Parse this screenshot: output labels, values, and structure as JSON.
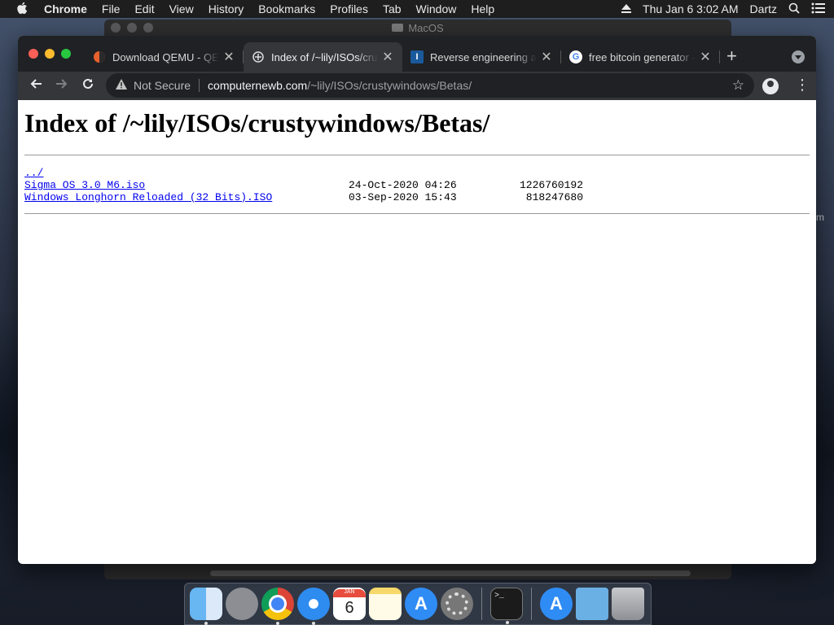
{
  "menubar": {
    "app_name": "Chrome",
    "items": [
      "File",
      "Edit",
      "View",
      "History",
      "Bookmarks",
      "Profiles",
      "Tab",
      "Window",
      "Help"
    ],
    "clock": "Thu Jan 6  3:02 AM",
    "user": "Dartz",
    "icons": [
      "apple-icon",
      "eject-icon",
      "spotlight-icon",
      "control-center-icon"
    ]
  },
  "bg_window": {
    "title": "MacOS"
  },
  "desktop": {
    "side_text": "m"
  },
  "browser": {
    "tabs": [
      {
        "title": "Download QEMU - QEMU",
        "favicon": "qemu-icon",
        "active": false
      },
      {
        "title": "Index of /~lily/ISOs/crustywindows/Betas/",
        "favicon": "site-icon",
        "active": true
      },
      {
        "title": "Reverse engineering and",
        "favicon": "I",
        "active": false
      },
      {
        "title": "free bitcoin generator - Google Search",
        "favicon": "G",
        "active": false
      }
    ],
    "new_tab_label": "+",
    "security_label": "Not Secure",
    "url_host": "computernewb.com",
    "url_path": "/~lily/ISOs/crustywindows/Betas/"
  },
  "page": {
    "heading": "Index of /~lily/ISOs/crustywindows/Betas/",
    "parent_link": "../",
    "files": [
      {
        "name": "Sigma OS 3.0 M6.iso",
        "date": "24-Oct-2020 04:26",
        "size": "1226760192"
      },
      {
        "name": "Windows Longhorn Reloaded (32 Bits).ISO",
        "date": "03-Sep-2020 15:43",
        "size": "818247680"
      }
    ]
  },
  "dock": {
    "calendar_month": "JAN",
    "calendar_day": "6",
    "items": [
      "finder",
      "launchpad",
      "chrome",
      "safari",
      "calendar",
      "notes",
      "app-store",
      "system-preferences",
      "terminal",
      "downloads",
      "folder",
      "trash"
    ]
  }
}
